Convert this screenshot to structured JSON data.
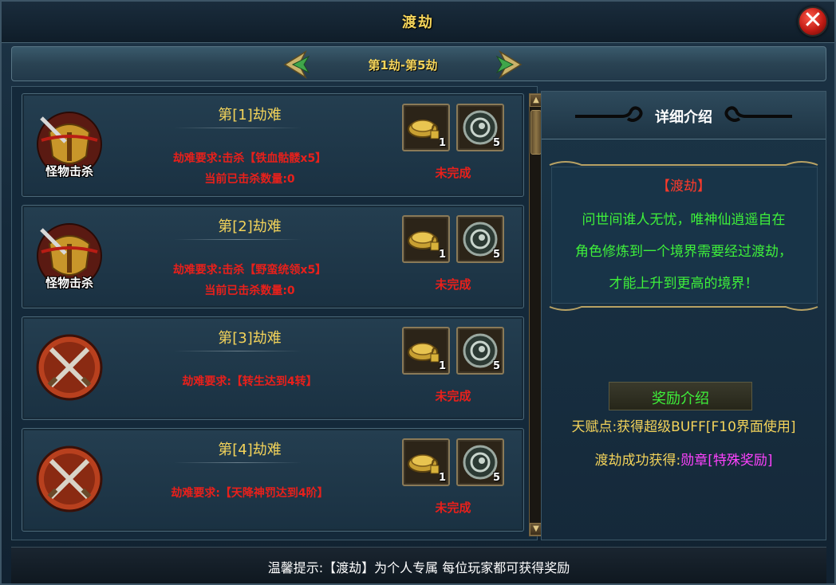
{
  "window": {
    "title": "渡劫",
    "close_symbol": "✕"
  },
  "nav": {
    "range_label": "第1劫-第5劫",
    "prev_icon": "left-arrow-icon",
    "next_icon": "right-arrow-icon"
  },
  "tribulations": [
    {
      "title": "第[1]劫难",
      "icon": "monster-kill-helmet-icon",
      "icon_label": "怪物击杀",
      "requirement": "劫难要求:击杀【铁血骷髅x5】",
      "progress": "当前已击杀数量:0",
      "status": "未完成",
      "rewards": [
        {
          "icon": "gold-coins-locked-icon",
          "count": "1"
        },
        {
          "icon": "jade-ring-icon",
          "count": "5"
        }
      ]
    },
    {
      "title": "第[2]劫难",
      "icon": "monster-kill-helmet-icon",
      "icon_label": "怪物击杀",
      "requirement": "劫难要求:击杀【野蛮统领x5】",
      "progress": "当前已击杀数量:0",
      "status": "未完成",
      "rewards": [
        {
          "icon": "gold-coins-locked-icon",
          "count": "1"
        },
        {
          "icon": "jade-ring-icon",
          "count": "5"
        }
      ]
    },
    {
      "title": "第[3]劫难",
      "icon": "crossed-swords-icon",
      "icon_label": "",
      "requirement": "劫难要求:【转生达到4转】",
      "progress": "",
      "status": "未完成",
      "rewards": [
        {
          "icon": "gold-coins-locked-icon",
          "count": "1"
        },
        {
          "icon": "jade-ring-icon",
          "count": "5"
        }
      ]
    },
    {
      "title": "第[4]劫难",
      "icon": "crossed-swords-icon",
      "icon_label": "",
      "requirement": "劫难要求:【天降神罚达到4阶】",
      "progress": "",
      "status": "未完成",
      "rewards": [
        {
          "icon": "gold-coins-locked-icon",
          "count": "1"
        },
        {
          "icon": "jade-ring-icon",
          "count": "5"
        }
      ]
    }
  ],
  "detail": {
    "header": "详细介绍",
    "intro_title": "【渡劫】",
    "intro_lines": [
      "问世间谁人无忧，唯神仙逍遥自在",
      "角色修炼到一个境界需要经过渡劫，",
      "才能上升到更高的境界！"
    ],
    "reward_tab": "奖励介绍",
    "talent_label": "天赋点:获得超级BUFF[F10界面使用]",
    "success_prefix": "渡劫成功获得:",
    "success_reward": "勋章[特殊奖励]"
  },
  "tip": "温馨提示:【渡劫】为个人专属 每位玩家都可获得奖励",
  "colors": {
    "title_gold": "#f3d35a",
    "requirement_red": "#e8201b",
    "intro_green": "#3ef03a",
    "reward_pink": "#ff42ff"
  }
}
